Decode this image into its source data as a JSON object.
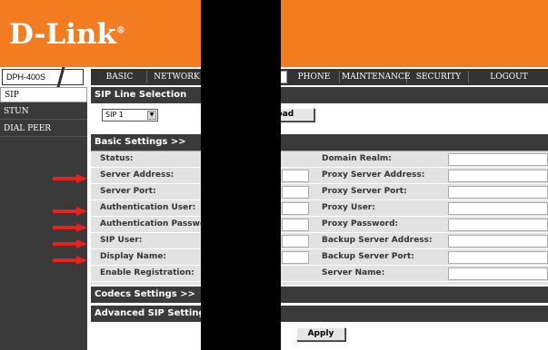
{
  "brand": {
    "logo": "D-Link",
    "reg": "®"
  },
  "model_tab": "DPH-400S",
  "nav": [
    "BASIC",
    "NETWORK",
    "",
    "PHONE",
    "MAINTENANCE",
    "SECURITY",
    "LOGOUT"
  ],
  "sidebar": [
    "SIP",
    "STUN",
    "DIAL PEER"
  ],
  "sip_line": {
    "title": "SIP Line Selection",
    "selected": "SIP 1",
    "load_button": "Load"
  },
  "basic": {
    "title": "Basic Settings >>",
    "left_labels": [
      "Status:",
      "Server Address:",
      "Server Port:",
      "Authentication User:",
      "Authentication Password:",
      "SIP User:",
      "Display Name:",
      "Enable Registration:"
    ],
    "right_labels": [
      "Domain Realm:",
      "Proxy Server Address:",
      "Proxy Server Port:",
      "Proxy User:",
      "Proxy Password:",
      "Backup Server Address:",
      "Backup Server Port:",
      "Server Name:"
    ]
  },
  "codecs_title": "Codecs Settings >>",
  "advanced_title": "Advanced SIP Settings >>",
  "apply_button": "Apply",
  "colors": {
    "banner": "#f47c20",
    "dark": "#3a3a3a",
    "arrow": "#e8231f"
  }
}
